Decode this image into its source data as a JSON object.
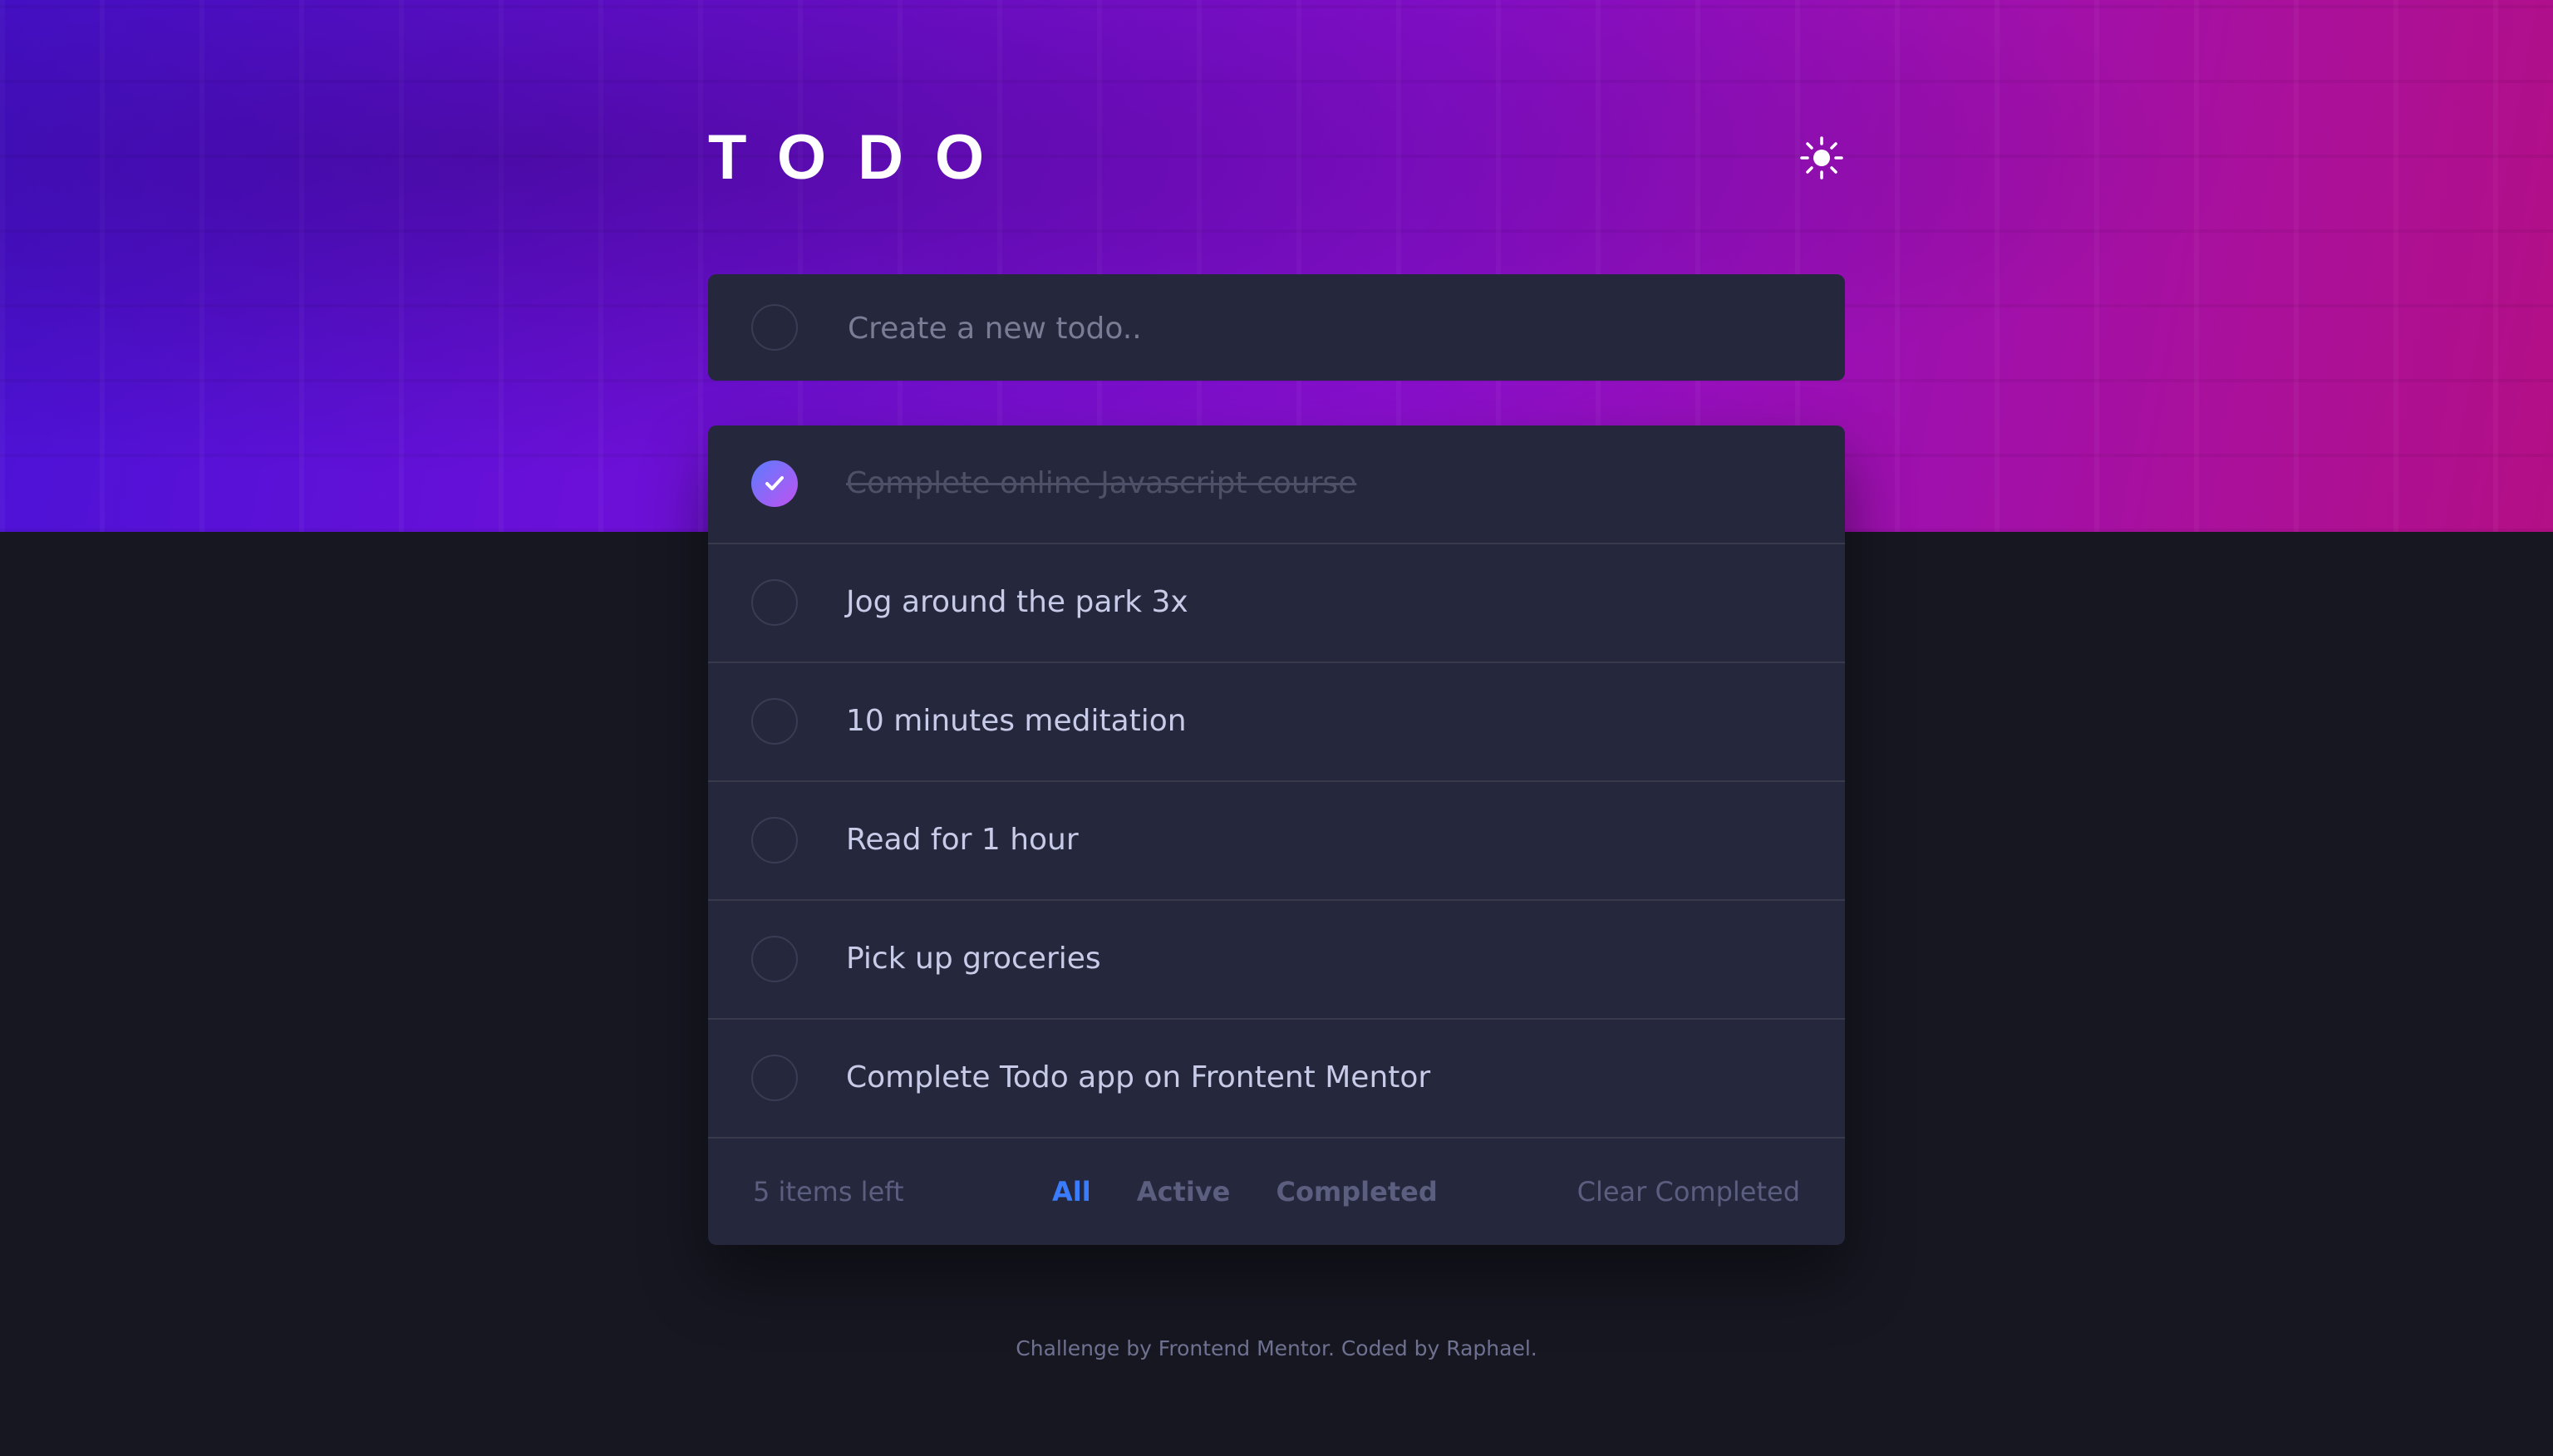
{
  "header": {
    "title": "TODO",
    "theme_icon": "sun-icon"
  },
  "new_todo": {
    "placeholder": "Create a new todo..",
    "value": ""
  },
  "todos": [
    {
      "text": "Complete online Javascript course",
      "completed": true
    },
    {
      "text": "Jog around the park 3x",
      "completed": false
    },
    {
      "text": "10 minutes meditation",
      "completed": false
    },
    {
      "text": "Read for 1 hour",
      "completed": false
    },
    {
      "text": "Pick up groceries",
      "completed": false
    },
    {
      "text": "Complete Todo app on Frontent Mentor",
      "completed": false
    }
  ],
  "footer": {
    "items_left": "5 items left",
    "filters": [
      "All",
      "Active",
      "Completed"
    ],
    "active_filter": "All",
    "clear_label": "Clear Completed"
  },
  "attribution": "Challenge by Frontend Mentor. Coded by Raphael.",
  "colors": {
    "accent": "#3a7cfd",
    "card": "#25273c",
    "background": "#171722",
    "check_gradient_start": "#5b7cff",
    "check_gradient_end": "#c052f0"
  }
}
